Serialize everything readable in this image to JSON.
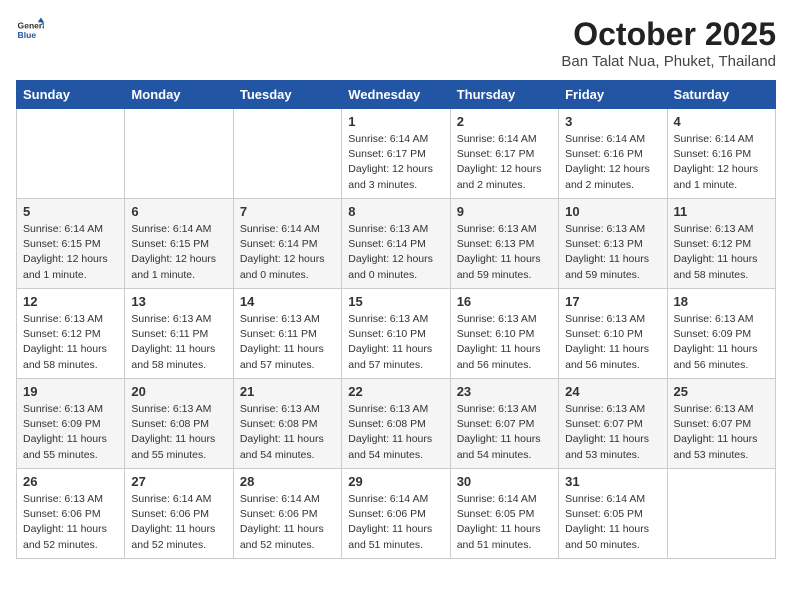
{
  "header": {
    "logo_general": "General",
    "logo_blue": "Blue",
    "month_title": "October 2025",
    "location": "Ban Talat Nua, Phuket, Thailand"
  },
  "days_of_week": [
    "Sunday",
    "Monday",
    "Tuesday",
    "Wednesday",
    "Thursday",
    "Friday",
    "Saturday"
  ],
  "weeks": [
    [
      {
        "day": "",
        "detail": ""
      },
      {
        "day": "",
        "detail": ""
      },
      {
        "day": "",
        "detail": ""
      },
      {
        "day": "1",
        "detail": "Sunrise: 6:14 AM\nSunset: 6:17 PM\nDaylight: 12 hours and 3 minutes."
      },
      {
        "day": "2",
        "detail": "Sunrise: 6:14 AM\nSunset: 6:17 PM\nDaylight: 12 hours and 2 minutes."
      },
      {
        "day": "3",
        "detail": "Sunrise: 6:14 AM\nSunset: 6:16 PM\nDaylight: 12 hours and 2 minutes."
      },
      {
        "day": "4",
        "detail": "Sunrise: 6:14 AM\nSunset: 6:16 PM\nDaylight: 12 hours and 1 minute."
      }
    ],
    [
      {
        "day": "5",
        "detail": "Sunrise: 6:14 AM\nSunset: 6:15 PM\nDaylight: 12 hours and 1 minute."
      },
      {
        "day": "6",
        "detail": "Sunrise: 6:14 AM\nSunset: 6:15 PM\nDaylight: 12 hours and 1 minute."
      },
      {
        "day": "7",
        "detail": "Sunrise: 6:14 AM\nSunset: 6:14 PM\nDaylight: 12 hours and 0 minutes."
      },
      {
        "day": "8",
        "detail": "Sunrise: 6:13 AM\nSunset: 6:14 PM\nDaylight: 12 hours and 0 minutes."
      },
      {
        "day": "9",
        "detail": "Sunrise: 6:13 AM\nSunset: 6:13 PM\nDaylight: 11 hours and 59 minutes."
      },
      {
        "day": "10",
        "detail": "Sunrise: 6:13 AM\nSunset: 6:13 PM\nDaylight: 11 hours and 59 minutes."
      },
      {
        "day": "11",
        "detail": "Sunrise: 6:13 AM\nSunset: 6:12 PM\nDaylight: 11 hours and 58 minutes."
      }
    ],
    [
      {
        "day": "12",
        "detail": "Sunrise: 6:13 AM\nSunset: 6:12 PM\nDaylight: 11 hours and 58 minutes."
      },
      {
        "day": "13",
        "detail": "Sunrise: 6:13 AM\nSunset: 6:11 PM\nDaylight: 11 hours and 58 minutes."
      },
      {
        "day": "14",
        "detail": "Sunrise: 6:13 AM\nSunset: 6:11 PM\nDaylight: 11 hours and 57 minutes."
      },
      {
        "day": "15",
        "detail": "Sunrise: 6:13 AM\nSunset: 6:10 PM\nDaylight: 11 hours and 57 minutes."
      },
      {
        "day": "16",
        "detail": "Sunrise: 6:13 AM\nSunset: 6:10 PM\nDaylight: 11 hours and 56 minutes."
      },
      {
        "day": "17",
        "detail": "Sunrise: 6:13 AM\nSunset: 6:10 PM\nDaylight: 11 hours and 56 minutes."
      },
      {
        "day": "18",
        "detail": "Sunrise: 6:13 AM\nSunset: 6:09 PM\nDaylight: 11 hours and 56 minutes."
      }
    ],
    [
      {
        "day": "19",
        "detail": "Sunrise: 6:13 AM\nSunset: 6:09 PM\nDaylight: 11 hours and 55 minutes."
      },
      {
        "day": "20",
        "detail": "Sunrise: 6:13 AM\nSunset: 6:08 PM\nDaylight: 11 hours and 55 minutes."
      },
      {
        "day": "21",
        "detail": "Sunrise: 6:13 AM\nSunset: 6:08 PM\nDaylight: 11 hours and 54 minutes."
      },
      {
        "day": "22",
        "detail": "Sunrise: 6:13 AM\nSunset: 6:08 PM\nDaylight: 11 hours and 54 minutes."
      },
      {
        "day": "23",
        "detail": "Sunrise: 6:13 AM\nSunset: 6:07 PM\nDaylight: 11 hours and 54 minutes."
      },
      {
        "day": "24",
        "detail": "Sunrise: 6:13 AM\nSunset: 6:07 PM\nDaylight: 11 hours and 53 minutes."
      },
      {
        "day": "25",
        "detail": "Sunrise: 6:13 AM\nSunset: 6:07 PM\nDaylight: 11 hours and 53 minutes."
      }
    ],
    [
      {
        "day": "26",
        "detail": "Sunrise: 6:13 AM\nSunset: 6:06 PM\nDaylight: 11 hours and 52 minutes."
      },
      {
        "day": "27",
        "detail": "Sunrise: 6:14 AM\nSunset: 6:06 PM\nDaylight: 11 hours and 52 minutes."
      },
      {
        "day": "28",
        "detail": "Sunrise: 6:14 AM\nSunset: 6:06 PM\nDaylight: 11 hours and 52 minutes."
      },
      {
        "day": "29",
        "detail": "Sunrise: 6:14 AM\nSunset: 6:06 PM\nDaylight: 11 hours and 51 minutes."
      },
      {
        "day": "30",
        "detail": "Sunrise: 6:14 AM\nSunset: 6:05 PM\nDaylight: 11 hours and 51 minutes."
      },
      {
        "day": "31",
        "detail": "Sunrise: 6:14 AM\nSunset: 6:05 PM\nDaylight: 11 hours and 50 minutes."
      },
      {
        "day": "",
        "detail": ""
      }
    ]
  ]
}
